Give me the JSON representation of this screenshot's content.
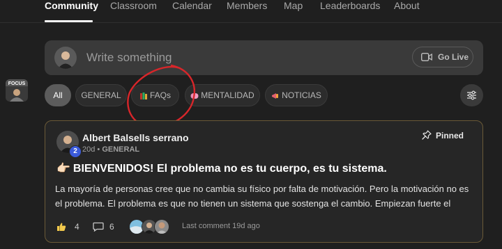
{
  "nav": {
    "tabs": [
      {
        "label": "Community",
        "active": true
      },
      {
        "label": "Classroom"
      },
      {
        "label": "Calendar"
      },
      {
        "label": "Members"
      },
      {
        "label": "Map"
      },
      {
        "label": "Leaderboards"
      },
      {
        "label": "About"
      }
    ]
  },
  "sidebar": {
    "thumb_text": "FOCUS"
  },
  "composer": {
    "placeholder": "Write something",
    "go_live_label": "Go Live"
  },
  "filters": {
    "chips": [
      {
        "label": "All",
        "active": true
      },
      {
        "label": "GENERAL"
      },
      {
        "label": "FAQs",
        "icon": "books-icon"
      },
      {
        "label": "MENTALIDAD",
        "icon": "brain-icon"
      },
      {
        "label": "NOTICIAS",
        "icon": "megaphone-icon"
      }
    ],
    "filter_icon": "sliders-icon"
  },
  "post": {
    "author": "Albert Balsells serrano",
    "level": "2",
    "age": "20d",
    "separator": "•",
    "category": "GENERAL",
    "pinned_label": "Pinned",
    "title_emoji": "👉🏻",
    "title": "BIENVENIDOS! El problema no es tu cuerpo, es tu sistema.",
    "body": "La mayoría de personas cree que no cambia su físico por falta de motivación. Pero la motivación no es el problema. El problema es que no tienen un sistema que sostenga el cambio. Empiezan fuerte el",
    "likes": "4",
    "comments": "6",
    "last_comment": "Last comment 19d ago"
  },
  "colors": {
    "accent_border": "#6b5a37",
    "level_badge": "#3b5bdb",
    "annotation_red": "#d8262a"
  }
}
